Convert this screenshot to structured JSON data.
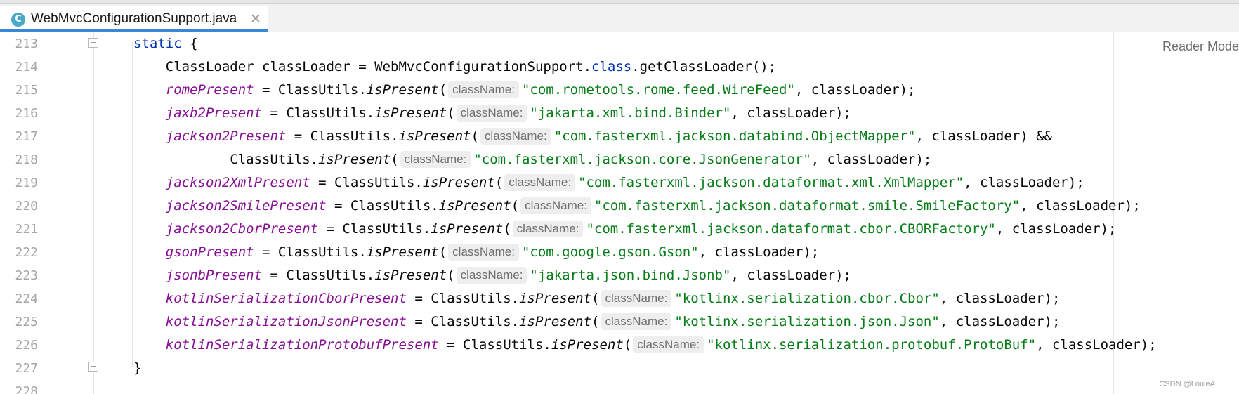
{
  "tab": {
    "icon_letter": "C",
    "file_name": "WebMvcConfigurationSupport.java",
    "close_glyph": "✕"
  },
  "reader_mode": "Reader Mode",
  "watermark": "CSDN @LouieA",
  "hint_label": "className:",
  "lines": [
    {
      "n": "213",
      "segs": [
        {
          "t": "kw",
          "v": "static"
        },
        {
          "t": "plain",
          "v": " {"
        }
      ]
    },
    {
      "n": "214",
      "segs": [
        {
          "t": "plain",
          "v": "    ClassLoader classLoader = WebMvcConfigurationSupport."
        },
        {
          "t": "kw",
          "v": "class"
        },
        {
          "t": "plain",
          "v": ".getClassLoader();"
        }
      ]
    },
    {
      "n": "215",
      "segs": [
        {
          "t": "plain",
          "v": "    "
        },
        {
          "t": "field",
          "v": "romePresent"
        },
        {
          "t": "plain",
          "v": " = ClassUtils."
        },
        {
          "t": "static",
          "v": "isPresent"
        },
        {
          "t": "plain",
          "v": "("
        },
        {
          "t": "hint",
          "v": "className:"
        },
        {
          "t": "str",
          "v": "\"com.rometools.rome.feed.WireFeed\""
        },
        {
          "t": "plain",
          "v": ", classLoader);"
        }
      ]
    },
    {
      "n": "216",
      "segs": [
        {
          "t": "plain",
          "v": "    "
        },
        {
          "t": "field",
          "v": "jaxb2Present"
        },
        {
          "t": "plain",
          "v": " = ClassUtils."
        },
        {
          "t": "static",
          "v": "isPresent"
        },
        {
          "t": "plain",
          "v": "("
        },
        {
          "t": "hint",
          "v": "className:"
        },
        {
          "t": "str",
          "v": "\"jakarta.xml.bind.Binder\""
        },
        {
          "t": "plain",
          "v": ", classLoader);"
        }
      ]
    },
    {
      "n": "217",
      "segs": [
        {
          "t": "plain",
          "v": "    "
        },
        {
          "t": "field",
          "v": "jackson2Present"
        },
        {
          "t": "plain",
          "v": " = ClassUtils."
        },
        {
          "t": "static",
          "v": "isPresent"
        },
        {
          "t": "plain",
          "v": "("
        },
        {
          "t": "hint",
          "v": "className:"
        },
        {
          "t": "str",
          "v": "\"com.fasterxml.jackson.databind.ObjectMapper\""
        },
        {
          "t": "plain",
          "v": ", classLoader) &&"
        }
      ]
    },
    {
      "n": "218",
      "segs": [
        {
          "t": "plain",
          "v": "            ClassUtils."
        },
        {
          "t": "static",
          "v": "isPresent"
        },
        {
          "t": "plain",
          "v": "("
        },
        {
          "t": "hint",
          "v": "className:"
        },
        {
          "t": "str",
          "v": "\"com.fasterxml.jackson.core.JsonGenerator\""
        },
        {
          "t": "plain",
          "v": ", classLoader);"
        }
      ]
    },
    {
      "n": "219",
      "segs": [
        {
          "t": "plain",
          "v": "    "
        },
        {
          "t": "field",
          "v": "jackson2XmlPresent"
        },
        {
          "t": "plain",
          "v": " = ClassUtils."
        },
        {
          "t": "static",
          "v": "isPresent"
        },
        {
          "t": "plain",
          "v": "("
        },
        {
          "t": "hint",
          "v": "className:"
        },
        {
          "t": "str",
          "v": "\"com.fasterxml.jackson.dataformat.xml.XmlMapper\""
        },
        {
          "t": "plain",
          "v": ", classLoader);"
        }
      ]
    },
    {
      "n": "220",
      "segs": [
        {
          "t": "plain",
          "v": "    "
        },
        {
          "t": "field",
          "v": "jackson2SmilePresent"
        },
        {
          "t": "plain",
          "v": " = ClassUtils."
        },
        {
          "t": "static",
          "v": "isPresent"
        },
        {
          "t": "plain",
          "v": "("
        },
        {
          "t": "hint",
          "v": "className:"
        },
        {
          "t": "str",
          "v": "\"com.fasterxml.jackson.dataformat.smile.SmileFactory\""
        },
        {
          "t": "plain",
          "v": ", classLoader);"
        }
      ]
    },
    {
      "n": "221",
      "segs": [
        {
          "t": "plain",
          "v": "    "
        },
        {
          "t": "field",
          "v": "jackson2CborPresent"
        },
        {
          "t": "plain",
          "v": " = ClassUtils."
        },
        {
          "t": "static",
          "v": "isPresent"
        },
        {
          "t": "plain",
          "v": "("
        },
        {
          "t": "hint",
          "v": "className:"
        },
        {
          "t": "str",
          "v": "\"com.fasterxml.jackson.dataformat.cbor.CBORFactory\""
        },
        {
          "t": "plain",
          "v": ", classLoader);"
        }
      ]
    },
    {
      "n": "222",
      "segs": [
        {
          "t": "plain",
          "v": "    "
        },
        {
          "t": "field",
          "v": "gsonPresent"
        },
        {
          "t": "plain",
          "v": " = ClassUtils."
        },
        {
          "t": "static",
          "v": "isPresent"
        },
        {
          "t": "plain",
          "v": "("
        },
        {
          "t": "hint",
          "v": "className:"
        },
        {
          "t": "str",
          "v": "\"com.google.gson.Gson\""
        },
        {
          "t": "plain",
          "v": ", classLoader);"
        }
      ]
    },
    {
      "n": "223",
      "segs": [
        {
          "t": "plain",
          "v": "    "
        },
        {
          "t": "field",
          "v": "jsonbPresent"
        },
        {
          "t": "plain",
          "v": " = ClassUtils."
        },
        {
          "t": "static",
          "v": "isPresent"
        },
        {
          "t": "plain",
          "v": "("
        },
        {
          "t": "hint",
          "v": "className:"
        },
        {
          "t": "str",
          "v": "\"jakarta.json.bind.Jsonb\""
        },
        {
          "t": "plain",
          "v": ", classLoader);"
        }
      ]
    },
    {
      "n": "224",
      "segs": [
        {
          "t": "plain",
          "v": "    "
        },
        {
          "t": "field",
          "v": "kotlinSerializationCborPresent"
        },
        {
          "t": "plain",
          "v": " = ClassUtils."
        },
        {
          "t": "static",
          "v": "isPresent"
        },
        {
          "t": "plain",
          "v": "("
        },
        {
          "t": "hint",
          "v": "className:"
        },
        {
          "t": "str",
          "v": "\"kotlinx.serialization.cbor.Cbor\""
        },
        {
          "t": "plain",
          "v": ", classLoader);"
        }
      ]
    },
    {
      "n": "225",
      "segs": [
        {
          "t": "plain",
          "v": "    "
        },
        {
          "t": "field",
          "v": "kotlinSerializationJsonPresent"
        },
        {
          "t": "plain",
          "v": " = ClassUtils."
        },
        {
          "t": "static",
          "v": "isPresent"
        },
        {
          "t": "plain",
          "v": "("
        },
        {
          "t": "hint",
          "v": "className:"
        },
        {
          "t": "str",
          "v": "\"kotlinx.serialization.json.Json\""
        },
        {
          "t": "plain",
          "v": ", classLoader);"
        }
      ]
    },
    {
      "n": "226",
      "segs": [
        {
          "t": "plain",
          "v": "    "
        },
        {
          "t": "field",
          "v": "kotlinSerializationProtobufPresent"
        },
        {
          "t": "plain",
          "v": " = ClassUtils."
        },
        {
          "t": "static",
          "v": "isPresent"
        },
        {
          "t": "plain",
          "v": "("
        },
        {
          "t": "hint",
          "v": "className:"
        },
        {
          "t": "str",
          "v": "\"kotlinx.serialization.protobuf.ProtoBuf\""
        },
        {
          "t": "plain",
          "v": ", classLoader);"
        }
      ]
    },
    {
      "n": "227",
      "segs": [
        {
          "t": "plain",
          "v": "}"
        }
      ]
    },
    {
      "n": "228",
      "segs": []
    }
  ],
  "colors": {
    "keyword": "#0033b3",
    "field": "#871094",
    "string": "#067d17",
    "tab_accent": "#3a87d8"
  }
}
